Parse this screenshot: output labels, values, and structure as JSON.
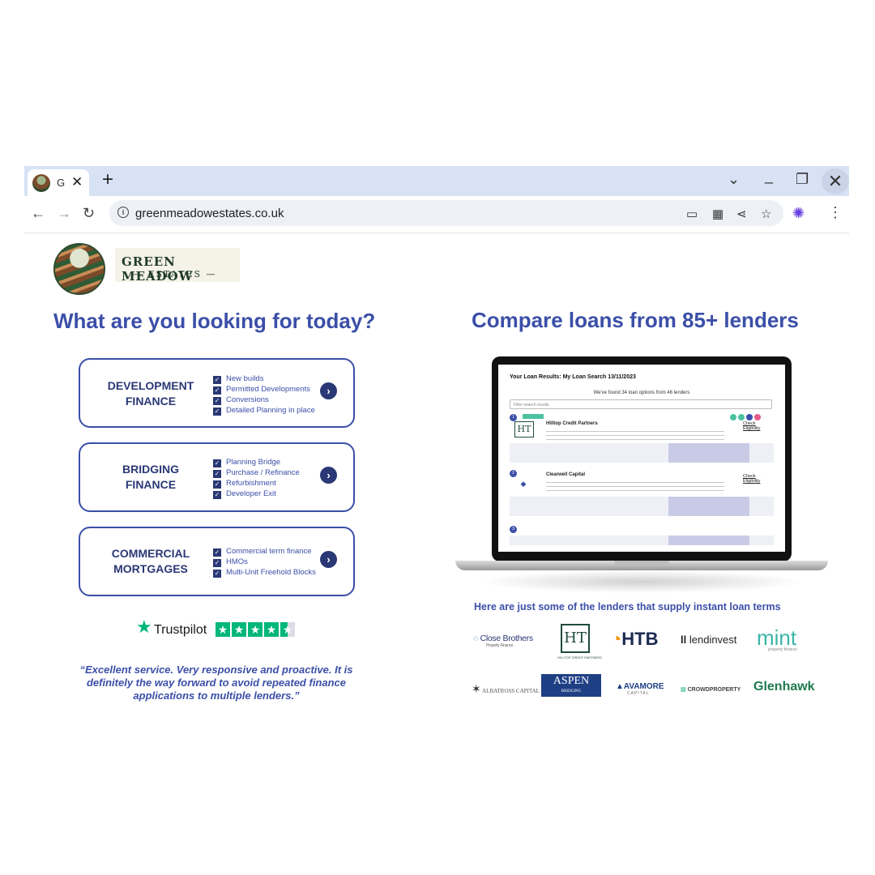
{
  "browser": {
    "tab_title": "G",
    "tab_close": "✕",
    "new_tab": "+",
    "url": "greenmeadowestates.co.uk"
  },
  "brand": {
    "name": "GREEN MEADOW",
    "sub": "— ESTATES —"
  },
  "left": {
    "heading": "What are you looking for today?",
    "cards": [
      {
        "title_line1": "DEVELOPMENT",
        "title_line2": "FINANCE",
        "items": [
          "New builds",
          "Permitted Developments",
          "Conversions",
          "Detailed Planning in place"
        ]
      },
      {
        "title_line1": "BRIDGING",
        "title_line2": "FINANCE",
        "items": [
          "Planning Bridge",
          "Purchase / Refinance",
          "Refurbishment",
          "Developer Exit"
        ]
      },
      {
        "title_line1": "COMMERCIAL",
        "title_line2": "MORTGAGES",
        "items": [
          "Commercial term finance",
          "HMOs",
          "Multi-Unit Freehold Blocks"
        ]
      }
    ],
    "trustpilot": {
      "word": "Trustpilot",
      "rating": 4.5
    },
    "quote": "“Excellent service. Very responsive and proactive. It is definitely the way forward to avoid repeated finance applications to multiple lenders.”"
  },
  "right": {
    "heading": "Compare loans from 85+ lenders",
    "screen": {
      "title": "Your Loan Results: My Loan Search 13/11/2023",
      "sub": "We've found 34 loan options from 46 lenders",
      "search_placeholder": "Filter search results",
      "results": [
        {
          "num": "1",
          "name": "Hilltop Credit Partners",
          "check": "Check Eligibility"
        },
        {
          "num": "2",
          "name": "Clearwell Capital",
          "check": "Check Eligibility"
        },
        {
          "num": "3"
        }
      ]
    },
    "lenders_heading": "Here are just some of the lenders that supply instant loan terms",
    "lenders": [
      "Close Brothers",
      "HT",
      "HTB",
      "lendinvest",
      "mint",
      "ALBATROSS CAPITAL",
      "ASPEN",
      "AVAMORE",
      "CROWDPROPERTY",
      "Glenhawk"
    ],
    "lender_subs": {
      "close_brothers": "Property Finance",
      "ht": "HILLTOP CREDIT PARTNERS",
      "mint": "property finance",
      "aspen": "BRIDGING",
      "avamore": "CAPITAL"
    }
  },
  "colors": {
    "brand_blue": "#3b4fa8",
    "navy": "#2a3875",
    "trustpilot_green": "#00b67a",
    "chrome_tab": "#d7e2f5"
  }
}
